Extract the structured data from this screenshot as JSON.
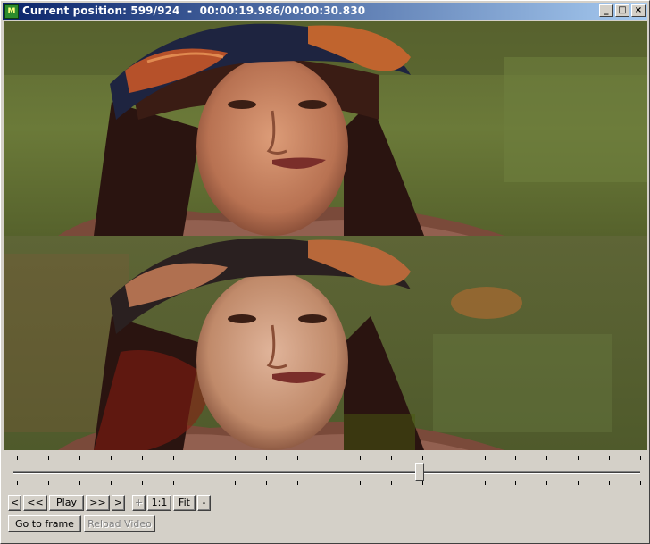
{
  "window": {
    "title": "Current position: 599/924  -  00:00:19.986/00:00:30.830",
    "app_icon_glyph": "M",
    "minimize_glyph": "_",
    "maximize_glyph": "□",
    "close_glyph": "×"
  },
  "playback": {
    "current_frame": 599,
    "total_frames": 924,
    "position_fraction": 0.648
  },
  "controls": {
    "prev_frame": "<",
    "rewind": "<<",
    "play": "Play",
    "fast_forward": ">>",
    "next_frame": ">",
    "zoom_in": "+",
    "zoom_1to1": "1:1",
    "fit": "Fit",
    "zoom_out": "-",
    "go_to_frame": "Go to frame",
    "reload_video": "Reload Video"
  },
  "colors": {
    "titlebar_start": "#0a246a",
    "titlebar_end": "#a6caf0",
    "window_bg": "#d4d0c8"
  }
}
